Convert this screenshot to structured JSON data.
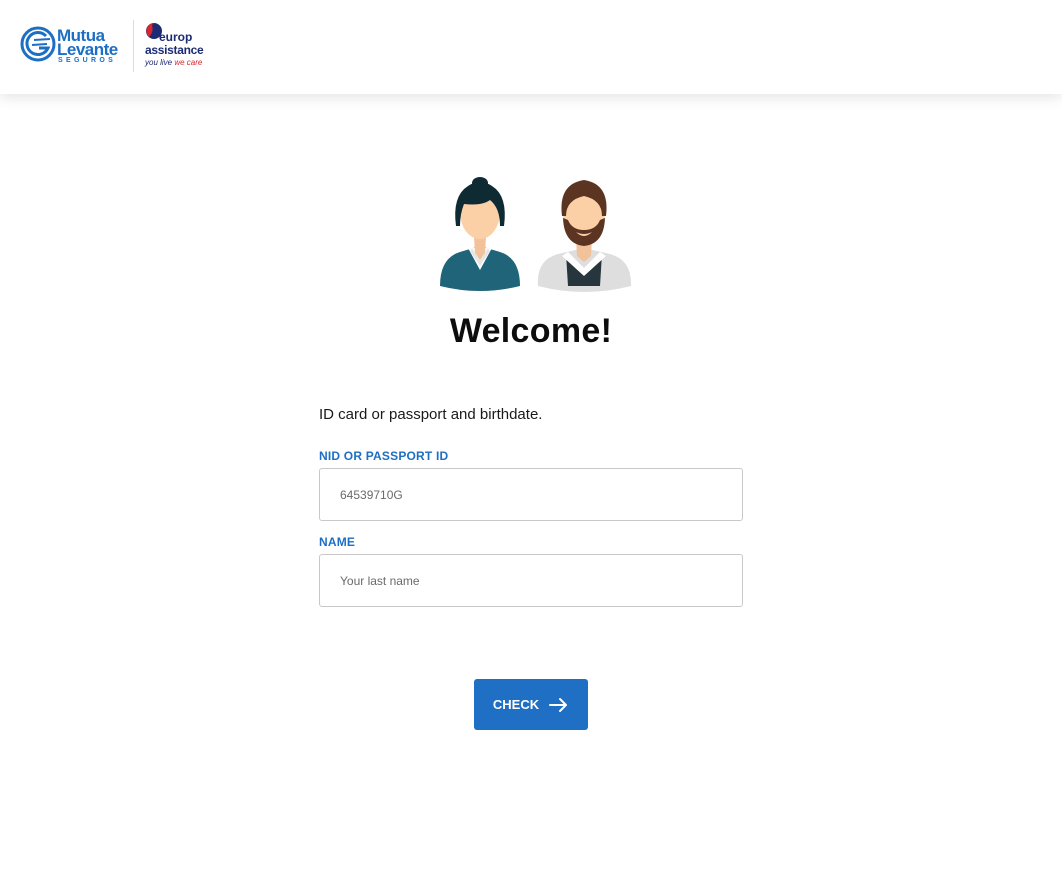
{
  "header": {
    "logo_mutua": {
      "line1": "Mutua",
      "line2": "Levante",
      "line3": "SEGUROS"
    },
    "logo_europ": {
      "line1": "europ",
      "line2": "assistance",
      "tagline_a": "you live",
      "tagline_b": "we care"
    }
  },
  "main": {
    "title": "Welcome!",
    "instructions": "ID card or passport and birthdate.",
    "nid_field": {
      "label": "NID OR PASSPORT ID",
      "placeholder": "64539710G"
    },
    "name_field": {
      "label": "NAME",
      "placeholder": "Your last name"
    },
    "check_button": {
      "label": "CHECK",
      "icon": "arrow-right-icon"
    }
  },
  "colors": {
    "accent": "#1f6fc5",
    "label_blue": "#1d6fc3",
    "europ_navy": "#1c2b73",
    "europ_red": "#d9262e"
  }
}
